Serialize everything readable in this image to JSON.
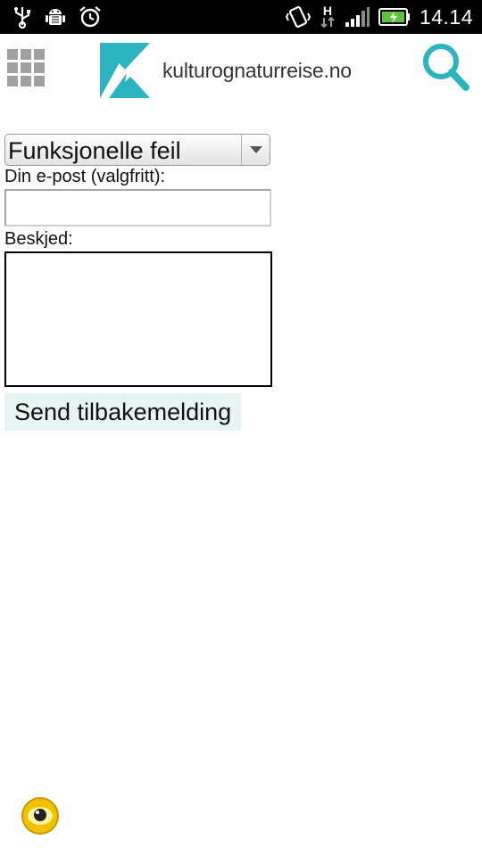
{
  "status_bar": {
    "time": "14.14",
    "icons": [
      "usb-icon",
      "android-debug-icon",
      "alarm-icon",
      "vibrate-icon",
      "hspa-data-icon",
      "signal-icon",
      "battery-charging-icon"
    ],
    "network_label": "H"
  },
  "header": {
    "menu_icon": "grid-menu-icon",
    "logo_text": "kulturognaturreise.no",
    "search_icon": "search-icon",
    "brand_color": "#2bb3c0"
  },
  "form": {
    "category_selected": "Funksjonelle feil",
    "email_label": "Din e-post (valgfritt):",
    "email_value": "",
    "message_label": "Beskjed:",
    "message_value": "",
    "submit_label": "Send tilbakemelding"
  }
}
